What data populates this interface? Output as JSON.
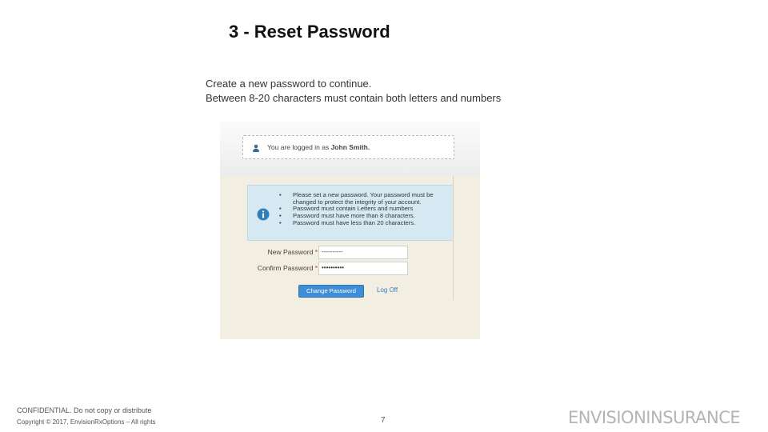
{
  "slide": {
    "title": "3 - Reset Password",
    "intro_line1": "Create a new password to continue.",
    "intro_line2": "Between 8-20 characters must contain both letters and numbers"
  },
  "screenshot": {
    "logged_in_prefix": "You are logged in as",
    "user_name": "John Smith.",
    "info_items": [
      "Please set a new password. Your password must be changed to protect the integrity of your account.",
      "Password must contain Letters and numbers",
      "Password must have more than 8 characters.",
      "Password must have less than 20 characters."
    ],
    "new_password_label": "New Password",
    "confirm_password_label": "Confirm Password",
    "required_mark": "*",
    "new_password_value": "----------",
    "confirm_password_value": "••••••••••",
    "change_button": "Change Password",
    "logoff_link": "Log Off",
    "icons": {
      "user": "user-icon",
      "info": "info-icon"
    },
    "colors": {
      "button": "#3d8ed6",
      "info_panel": "#d6e9f3",
      "background": "#f3eee2"
    }
  },
  "footer": {
    "confidential": "CONFIDENTIAL. Do not copy or distribute",
    "copyright": "Copyright © 2017, EnvisionRxOptions – All rights",
    "page_number": "7",
    "logo_text": "ENVISIONINSURANCE"
  }
}
